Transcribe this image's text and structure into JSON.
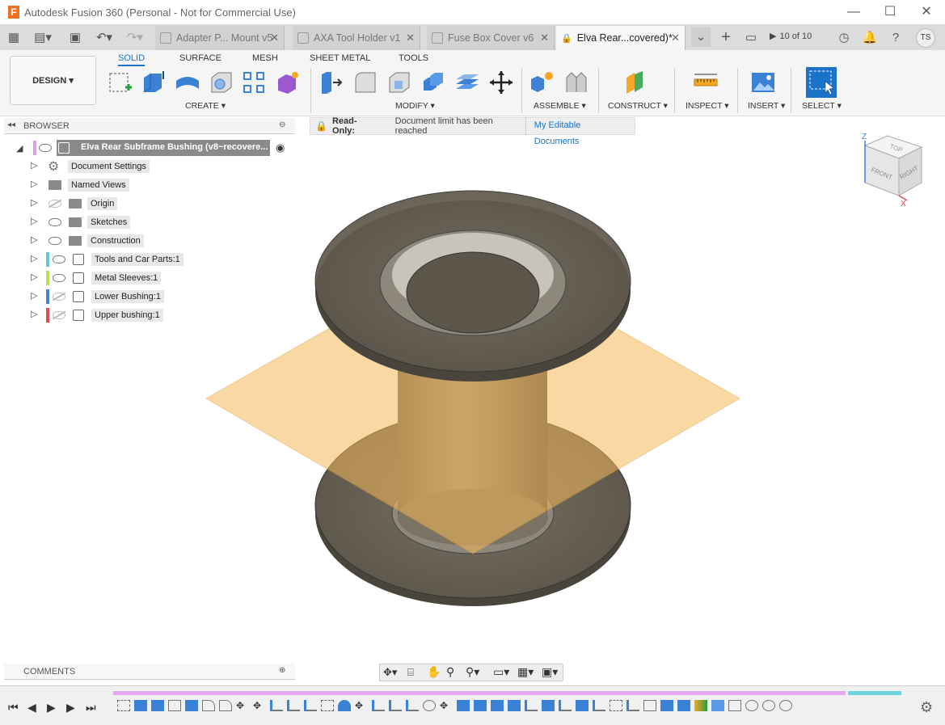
{
  "window": {
    "title": "Autodesk Fusion 360 (Personal - Not for Commercial Use)",
    "app_icon_letter": "F",
    "minimize": "—",
    "maximize": "☐",
    "close": "✕"
  },
  "tabs": [
    {
      "label": "Adapter P... Mount v5"
    },
    {
      "label": "AXA Tool Holder v1"
    },
    {
      "label": "Fuse Box Cover v6"
    },
    {
      "label": "Elva Rear...covered)*"
    }
  ],
  "tab_close": "✕",
  "top_right": {
    "count": "10 of 10",
    "user": "TS"
  },
  "ribbon": {
    "design": "DESIGN ▾",
    "tabs": [
      "SOLID",
      "SURFACE",
      "MESH",
      "SHEET METAL",
      "TOOLS"
    ],
    "groups": [
      "CREATE ▾",
      "MODIFY ▾",
      "ASSEMBLE ▾",
      "CONSTRUCT ▾",
      "INSPECT ▾",
      "INSERT ▾",
      "SELECT ▾"
    ]
  },
  "browser": {
    "title": "BROWSER",
    "root": "Elva Rear Subframe Bushing (v8~recovere...",
    "items": [
      {
        "label": "Document Settings"
      },
      {
        "label": "Named Views"
      },
      {
        "label": "Origin"
      },
      {
        "label": "Sketches"
      },
      {
        "label": "Construction"
      },
      {
        "label": "Tools and Car Parts:1"
      },
      {
        "label": "Metal Sleeves:1"
      },
      {
        "label": "Lower Bushing:1"
      },
      {
        "label": "Upper bushing:1"
      }
    ]
  },
  "readonly": {
    "title": "Read-Only:",
    "message": "Document limit has been reached",
    "link": "My Editable Documents"
  },
  "viewcube": {
    "top": "TOP",
    "front": "FRONT",
    "right": "RIGHT",
    "z": "Z",
    "x": "X"
  },
  "comments": {
    "title": "COMMENTS"
  },
  "colors": {
    "accent": "#1a73c8",
    "plane": "#f5b95b",
    "part": "#6e665a"
  }
}
